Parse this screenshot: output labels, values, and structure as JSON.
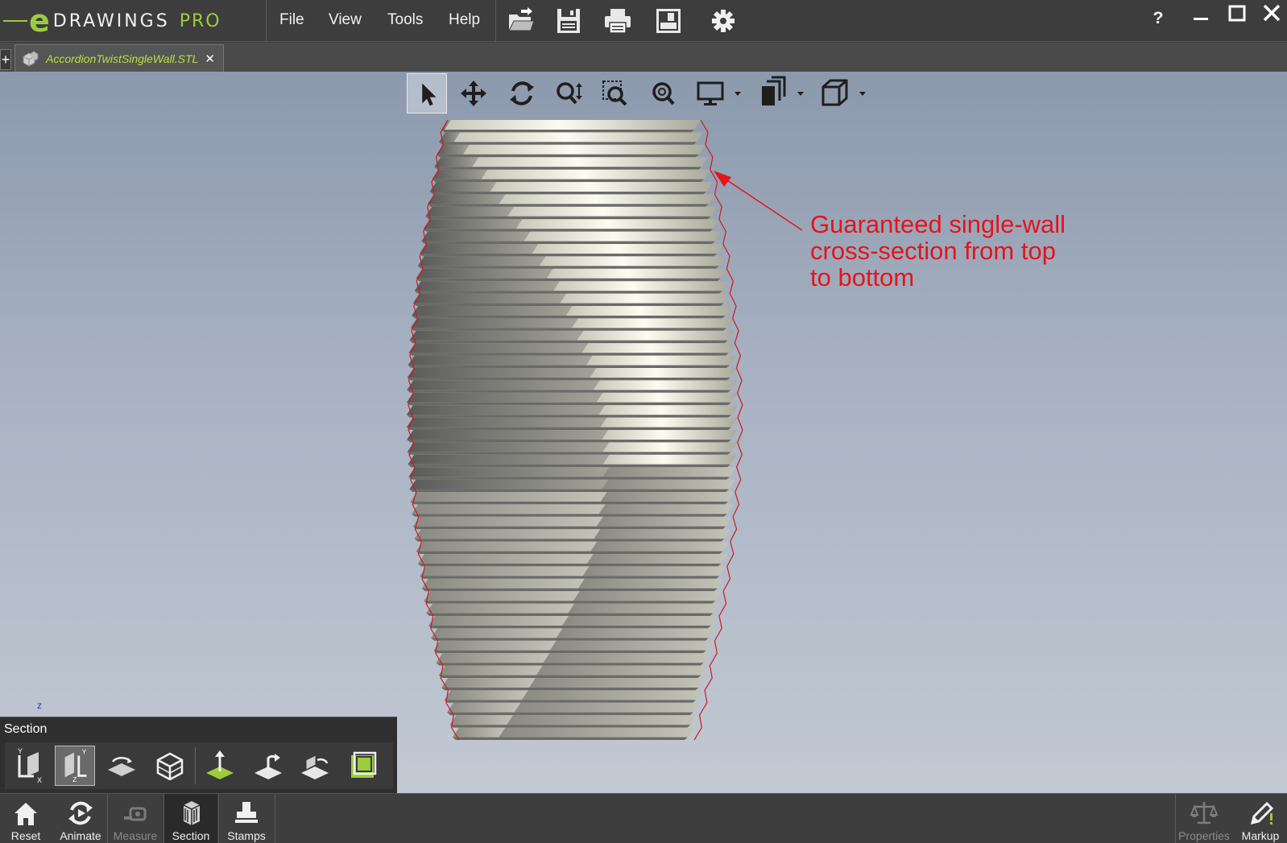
{
  "app": {
    "logo_e": "e",
    "logo_name": "DRAWINGS",
    "logo_edition": "PRO"
  },
  "menu": {
    "items": [
      {
        "label": "File"
      },
      {
        "label": "View"
      },
      {
        "label": "Tools"
      },
      {
        "label": "Help"
      }
    ]
  },
  "toolbar_icons": [
    "open-icon",
    "save-icon",
    "print-icon",
    "publish-icon",
    "settings-icon"
  ],
  "window_controls": [
    "help-icon",
    "minimize-icon",
    "maximize-icon",
    "close-icon"
  ],
  "tabs": {
    "add_label": "+",
    "document": {
      "label": "AccordionTwistSingleWall.STL",
      "close": "✕"
    }
  },
  "view_toolbar": [
    "select-icon",
    "pan-icon",
    "rotate-icon",
    "zoom-icon",
    "zoom-to-area-icon",
    "zoom-to-fit-icon",
    "display-icon",
    "views-icon",
    "cube-view-icon"
  ],
  "annotation": {
    "text": "Guaranteed single-wall\ncross-section from top\nto bottom",
    "color": "#e4141b"
  },
  "section_panel": {
    "title": "Section",
    "tools": [
      "section-xy-plane-icon",
      "section-yz-plane-icon",
      "section-zx-plane-icon",
      "section-cap-icon",
      "section-flip-icon",
      "section-rotate-icon",
      "section-move-icon",
      "section-render-icon"
    ]
  },
  "bottom_bar": {
    "items": [
      {
        "label": "Reset",
        "icon": "home-icon",
        "enabled": true
      },
      {
        "label": "Animate",
        "icon": "animate-icon",
        "enabled": true
      },
      {
        "label": "Measure",
        "icon": "measure-icon",
        "enabled": false
      },
      {
        "label": "Section",
        "icon": "section-icon",
        "enabled": true
      },
      {
        "label": "Stamps",
        "icon": "stamps-icon",
        "enabled": true
      },
      {
        "label": "Properties",
        "icon": "properties-icon",
        "enabled": false
      },
      {
        "label": "Markup",
        "icon": "markup-icon",
        "enabled": true
      }
    ]
  },
  "colors": {
    "brand": "#9ccc3d",
    "annotation": "#e4141b",
    "tab_label": "#b8e23a"
  }
}
